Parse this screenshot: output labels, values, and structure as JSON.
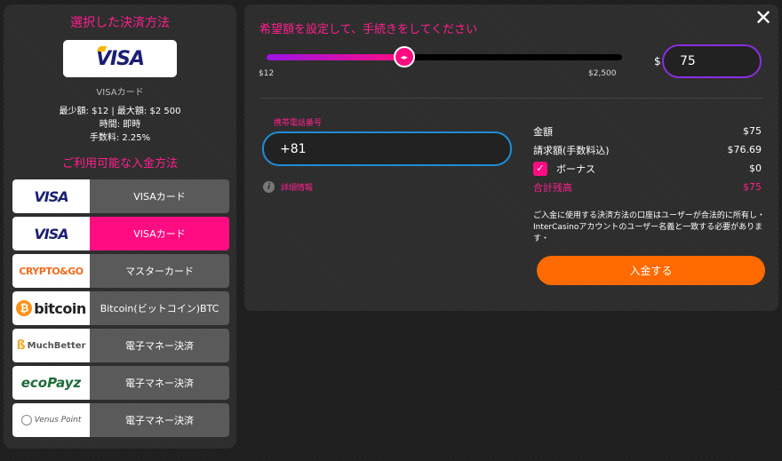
{
  "left": {
    "title": "選択した決済方法",
    "selected_logo": "VISA",
    "selected_name": "VISAカード",
    "limits": "最少額: $12 | 最大額: $2 500",
    "time": "時間: 即時",
    "fee": "手数料: 2.25%",
    "available_title": "ご利用可能な入金方法",
    "methods": [
      {
        "logo": "VISA",
        "label": "VISAカード"
      },
      {
        "logo": "VISA",
        "label": "VISAカード"
      },
      {
        "logo": "CRYPTO&GO",
        "label": "マスターカード"
      },
      {
        "logo": "bitcoin",
        "label": "Bitcoin(ビットコイン)BTC"
      },
      {
        "logo": "MuchBetter",
        "label": "電子マネー決済"
      },
      {
        "logo": "ecoPayz",
        "label": "電子マネー決済"
      },
      {
        "logo": "Venus Point",
        "label": "電子マネー決済"
      }
    ]
  },
  "right": {
    "title": "希望額を設定して、手続きをしてください",
    "slider": {
      "min_label": "$12",
      "max_label": "$2,500",
      "fill_fraction": 0.387
    },
    "currency": "$",
    "amount_value": "75",
    "phone_label": "携帯電話番号",
    "phone_value": "+81",
    "detail_label": "詳細情報",
    "summary": {
      "amount_label": "金額",
      "amount_value": "$75",
      "billed_label": "請求額(手数料込)",
      "billed_value": "$76.69",
      "bonus_label": "ボーナス",
      "bonus_value": "$0",
      "total_label": "合計残高",
      "total_value": "$75"
    },
    "notice": "ご入金に使用する決済方法の口座はユーザーが合法的に所有し・InterCasinoアカウントのユーザー名義と一致する必要があります・",
    "deposit_label": "入金する"
  },
  "icons": {
    "close": "close-icon",
    "info": "info-icon",
    "check": "check-icon"
  },
  "colors": {
    "accent": "#ff0c82",
    "button": "#ff6a00",
    "phone_border": "#1c8ed9",
    "amount_border": "#8a2ee0"
  }
}
